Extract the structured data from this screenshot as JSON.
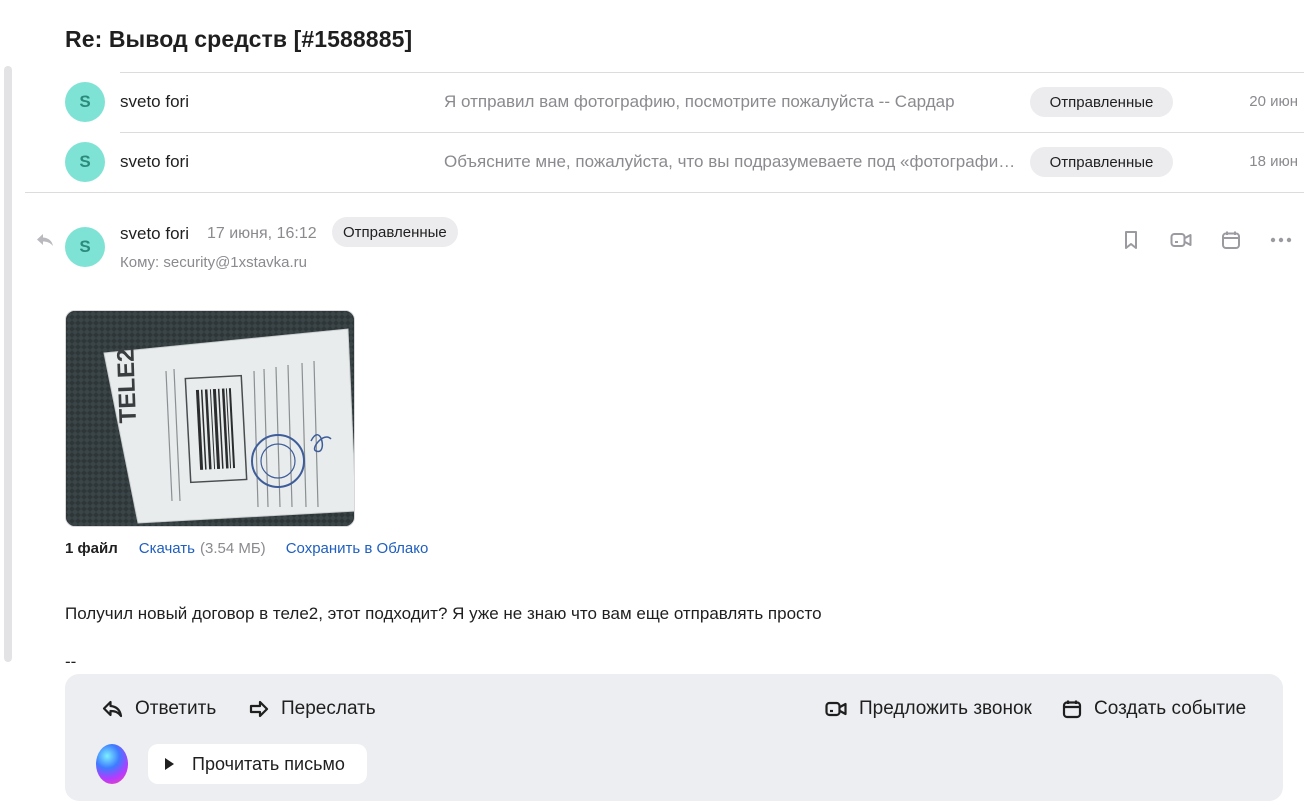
{
  "subject": "Re: Вывод средств [#1588885]",
  "thread": [
    {
      "avatar_letter": "S",
      "sender": "sveto fori",
      "snippet": "Я отправил вам фотографию, посмотрите пожалуйста -- Сардар",
      "folder": "Отправленные",
      "date": "20 июн"
    },
    {
      "avatar_letter": "S",
      "sender": "sveto fori",
      "snippet": "Объясните мне, пожалуйста, что вы подразумеваете под «фотографию»",
      "folder": "Отправленные",
      "date": "18 июн"
    }
  ],
  "message": {
    "avatar_letter": "S",
    "sender": "sveto fori",
    "date": "17 июня, 16:12",
    "folder": "Отправленные",
    "to": "Кому: security@1xstavka.ru",
    "attachment": {
      "count_label": "1 файл",
      "download_label": "Скачать",
      "size": "(3.54 МБ)",
      "save_label": "Сохранить в Облако"
    },
    "body": "Получил новый договор в теле2, этот подходит? Я уже не знаю что вам еще отправлять просто",
    "signature_dash": "--"
  },
  "top_icons": [
    "bookmark-icon",
    "video-call-icon",
    "calendar-icon",
    "more-icon"
  ],
  "panel": {
    "reply_label": "Ответить",
    "forward_label": "Переслать",
    "call_label": "Предложить звонок",
    "event_label": "Создать событие",
    "read_label": "Прочитать письмо"
  }
}
